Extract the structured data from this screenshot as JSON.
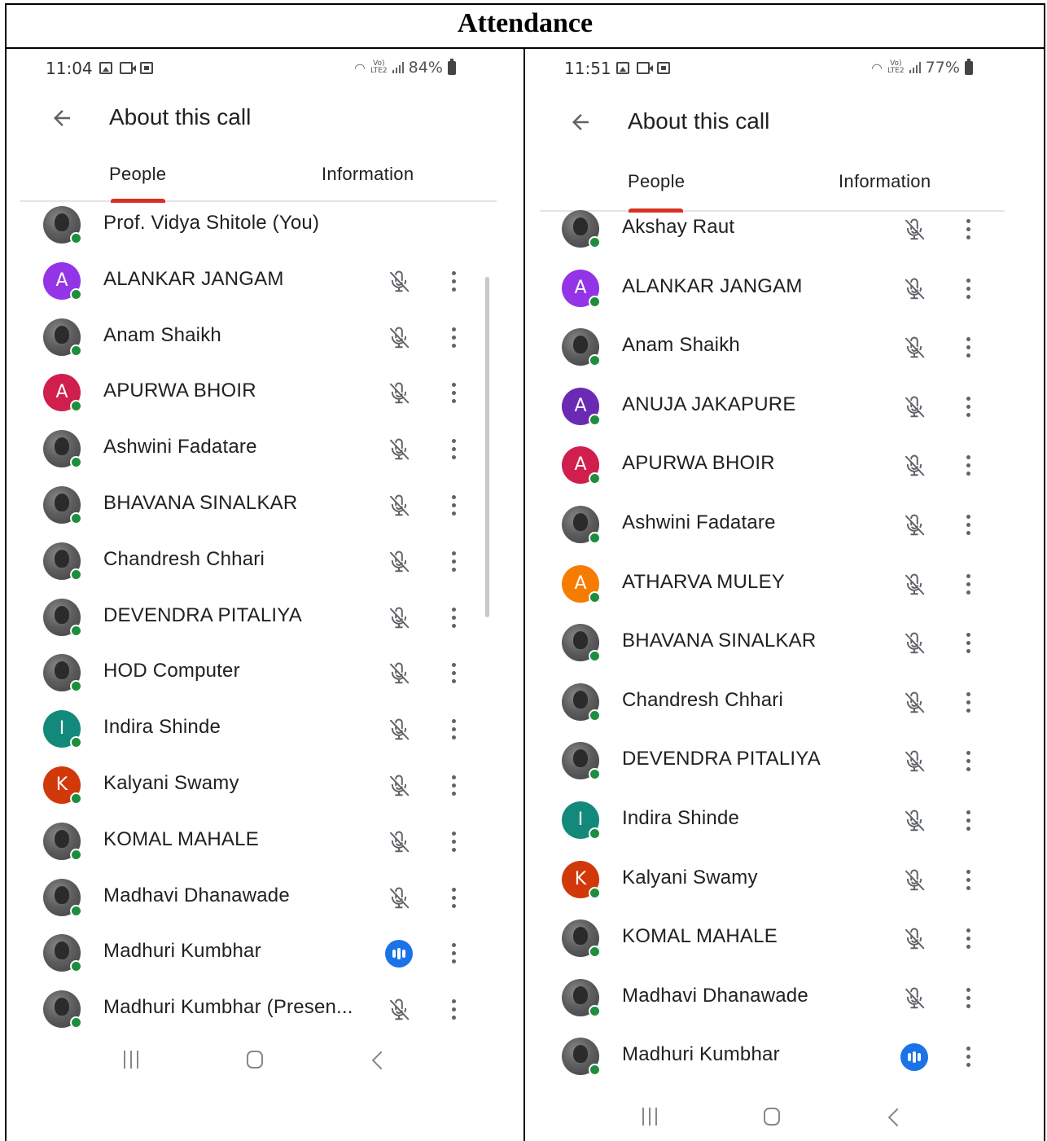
{
  "page_title": "Attendance",
  "colors": {
    "tab_indicator": "#d93025",
    "online_dot": "#1e8e3e",
    "speaking": "#1a73e8",
    "divider": "#e4e4e4"
  },
  "screens": [
    {
      "status": {
        "time": "11:04",
        "battery": "84%"
      },
      "appbar": {
        "title": "About this call"
      },
      "tabs": {
        "people": "People",
        "information": "Information"
      },
      "participants": [
        {
          "name": "Prof. Vidya Shitole (You)",
          "avatar": "photo",
          "status": "none"
        },
        {
          "name": "ALANKAR JANGAM",
          "avatar": "A",
          "color": "#9334e6",
          "status": "muted"
        },
        {
          "name": "Anam Shaikh",
          "avatar": "photo",
          "status": "muted"
        },
        {
          "name": "APURWA BHOIR",
          "avatar": "A",
          "color": "#d01f4d",
          "status": "muted"
        },
        {
          "name": "Ashwini Fadatare",
          "avatar": "photo",
          "status": "muted"
        },
        {
          "name": "BHAVANA SINALKAR",
          "avatar": "photo",
          "status": "muted"
        },
        {
          "name": "Chandresh Chhari",
          "avatar": "photo",
          "status": "muted"
        },
        {
          "name": "DEVENDRA PITALIYA",
          "avatar": "photo",
          "status": "muted"
        },
        {
          "name": "HOD Computer",
          "avatar": "photo",
          "status": "muted"
        },
        {
          "name": "Indira Shinde",
          "avatar": "I",
          "color": "#12897a",
          "status": "muted"
        },
        {
          "name": "Kalyani Swamy",
          "avatar": "K",
          "color": "#d1380a",
          "status": "muted"
        },
        {
          "name": "KOMAL MAHALE",
          "avatar": "photo",
          "status": "muted"
        },
        {
          "name": "Madhavi Dhanawade",
          "avatar": "photo",
          "status": "muted"
        },
        {
          "name": "Madhuri Kumbhar",
          "avatar": "photo",
          "status": "speaking"
        },
        {
          "name": "Madhuri Kumbhar (Presen...",
          "avatar": "photo",
          "status": "muted"
        }
      ]
    },
    {
      "status": {
        "time": "11:51",
        "battery": "77%"
      },
      "appbar": {
        "title": "About this call"
      },
      "tabs": {
        "people": "People",
        "information": "Information"
      },
      "participants": [
        {
          "name": "Akshay Raut",
          "avatar": "photo",
          "status": "muted"
        },
        {
          "name": "ALANKAR JANGAM",
          "avatar": "A",
          "color": "#9334e6",
          "status": "muted"
        },
        {
          "name": "Anam Shaikh",
          "avatar": "photo",
          "status": "muted"
        },
        {
          "name": "ANUJA JAKAPURE",
          "avatar": "A",
          "color": "#6a2ab4",
          "status": "muted"
        },
        {
          "name": "APURWA BHOIR",
          "avatar": "A",
          "color": "#d01f4d",
          "status": "muted"
        },
        {
          "name": "Ashwini Fadatare",
          "avatar": "photo",
          "status": "muted"
        },
        {
          "name": "ATHARVA MULEY",
          "avatar": "A",
          "color": "#f57c00",
          "status": "muted"
        },
        {
          "name": "BHAVANA SINALKAR",
          "avatar": "photo",
          "status": "muted"
        },
        {
          "name": "Chandresh Chhari",
          "avatar": "photo",
          "status": "muted"
        },
        {
          "name": "DEVENDRA PITALIYA",
          "avatar": "photo",
          "status": "muted"
        },
        {
          "name": "Indira Shinde",
          "avatar": "I",
          "color": "#12897a",
          "status": "muted"
        },
        {
          "name": "Kalyani Swamy",
          "avatar": "K",
          "color": "#d1380a",
          "status": "muted"
        },
        {
          "name": "KOMAL MAHALE",
          "avatar": "photo",
          "status": "muted"
        },
        {
          "name": "Madhavi Dhanawade",
          "avatar": "photo",
          "status": "muted"
        },
        {
          "name": "Madhuri Kumbhar",
          "avatar": "photo",
          "status": "speaking"
        }
      ]
    }
  ]
}
